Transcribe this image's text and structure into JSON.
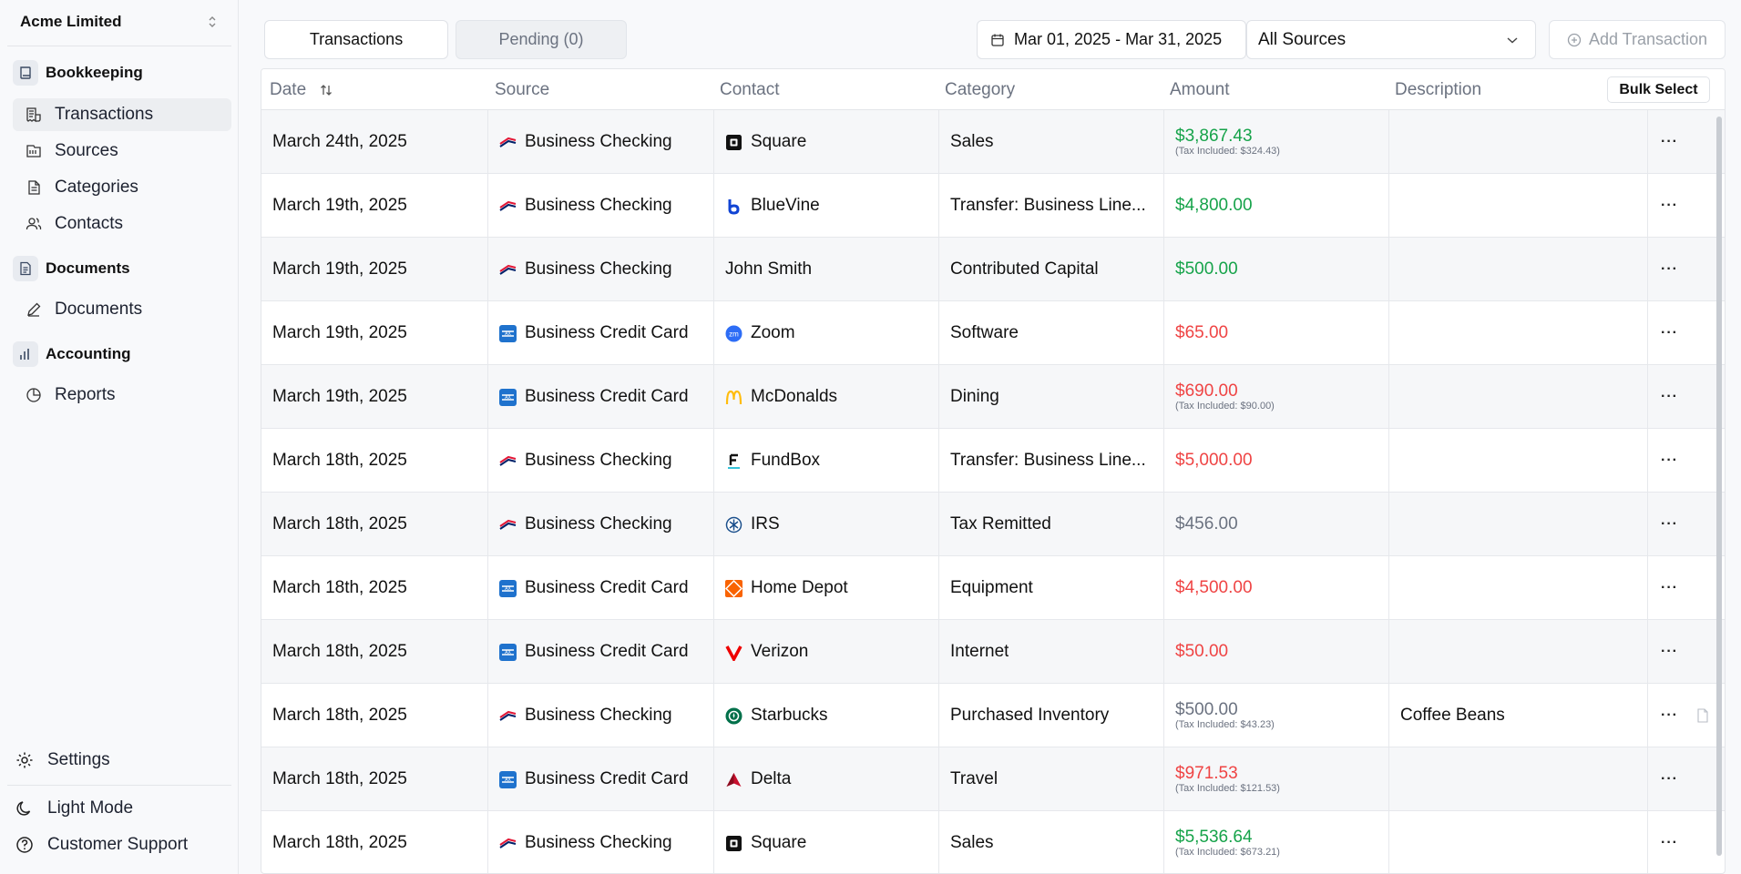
{
  "sidebar": {
    "company": "Acme Limited",
    "sections": [
      {
        "label": "Bookkeeping",
        "icon": "book-icon",
        "items": [
          {
            "label": "Transactions",
            "icon": "receipt-icon",
            "active": true
          },
          {
            "label": "Sources",
            "icon": "bank-icon"
          },
          {
            "label": "Categories",
            "icon": "file-list-icon"
          },
          {
            "label": "Contacts",
            "icon": "users-icon"
          }
        ]
      },
      {
        "label": "Documents",
        "icon": "document-icon",
        "items": [
          {
            "label": "Documents",
            "icon": "pencil-icon"
          }
        ]
      },
      {
        "label": "Accounting",
        "icon": "bar-chart-icon",
        "items": [
          {
            "label": "Reports",
            "icon": "pie-chart-icon"
          }
        ]
      }
    ],
    "settings": "Settings",
    "light_mode": "Light Mode",
    "support": "Customer Support"
  },
  "toolbar": {
    "tab_transactions": "Transactions",
    "tab_pending": "Pending (0)",
    "date_range": "Mar 01, 2025 - Mar 31, 2025",
    "sources": "All Sources",
    "add": "Add Transaction"
  },
  "table": {
    "headers": {
      "date": "Date",
      "source": "Source",
      "contact": "Contact",
      "category": "Category",
      "amount": "Amount",
      "description": "Description"
    },
    "bulk_select": "Bulk Select",
    "rows": [
      {
        "date": "March 24th, 2025",
        "source": "Business Checking",
        "source_logo": "bank-of-america",
        "contact": "Square",
        "contact_logo": "square",
        "category": "Sales",
        "amount": "$3,867.43",
        "amount_color": "#16a34a",
        "tax": "(Tax Included: $324.43)",
        "description": ""
      },
      {
        "date": "March 19th, 2025",
        "source": "Business Checking",
        "source_logo": "bank-of-america",
        "contact": "BlueVine",
        "contact_logo": "bluevine",
        "category": "Transfer: Business Line...",
        "amount": "$4,800.00",
        "amount_color": "#16a34a",
        "tax": "",
        "description": ""
      },
      {
        "date": "March 19th, 2025",
        "source": "Business Checking",
        "source_logo": "bank-of-america",
        "contact": "John Smith",
        "contact_logo": "",
        "category": "Contributed Capital",
        "amount": "$500.00",
        "amount_color": "#16a34a",
        "tax": "",
        "description": ""
      },
      {
        "date": "March 19th, 2025",
        "source": "Business Credit Card",
        "source_logo": "amex",
        "contact": "Zoom",
        "contact_logo": "zoom",
        "category": "Software",
        "amount": "$65.00",
        "amount_color": "#ef4444",
        "tax": "",
        "description": ""
      },
      {
        "date": "March 19th, 2025",
        "source": "Business Credit Card",
        "source_logo": "amex",
        "contact": "McDonalds",
        "contact_logo": "mcdonalds",
        "category": "Dining",
        "amount": "$690.00",
        "amount_color": "#ef4444",
        "tax": "(Tax Included: $90.00)",
        "description": ""
      },
      {
        "date": "March 18th, 2025",
        "source": "Business Checking",
        "source_logo": "bank-of-america",
        "contact": "FundBox",
        "contact_logo": "fundbox",
        "category": "Transfer: Business Line...",
        "amount": "$5,000.00",
        "amount_color": "#ef4444",
        "tax": "",
        "description": ""
      },
      {
        "date": "March 18th, 2025",
        "source": "Business Checking",
        "source_logo": "bank-of-america",
        "contact": "IRS",
        "contact_logo": "irs",
        "category": "Tax Remitted",
        "amount": "$456.00",
        "amount_color": "#6b7280",
        "tax": "",
        "description": ""
      },
      {
        "date": "March 18th, 2025",
        "source": "Business Credit Card",
        "source_logo": "amex",
        "contact": "Home Depot",
        "contact_logo": "home-depot",
        "category": "Equipment",
        "amount": "$4,500.00",
        "amount_color": "#ef4444",
        "tax": "",
        "description": ""
      },
      {
        "date": "March 18th, 2025",
        "source": "Business Credit Card",
        "source_logo": "amex",
        "contact": "Verizon",
        "contact_logo": "verizon",
        "category": "Internet",
        "amount": "$50.00",
        "amount_color": "#ef4444",
        "tax": "",
        "description": ""
      },
      {
        "date": "March 18th, 2025",
        "source": "Business Checking",
        "source_logo": "bank-of-america",
        "contact": "Starbucks",
        "contact_logo": "starbucks",
        "category": "Purchased Inventory",
        "amount": "$500.00",
        "amount_color": "#6b7280",
        "tax": "(Tax Included: $43.23)",
        "description": "Coffee Beans",
        "has_attachment": true
      },
      {
        "date": "March 18th, 2025",
        "source": "Business Credit Card",
        "source_logo": "amex",
        "contact": "Delta",
        "contact_logo": "delta",
        "category": "Travel",
        "amount": "$971.53",
        "amount_color": "#ef4444",
        "tax": "(Tax Included: $121.53)",
        "description": ""
      },
      {
        "date": "March 18th, 2025",
        "source": "Business Checking",
        "source_logo": "bank-of-america",
        "contact": "Square",
        "contact_logo": "square",
        "category": "Sales",
        "amount": "$5,536.64",
        "amount_color": "#16a34a",
        "tax": "(Tax Included: $673.21)",
        "description": ""
      }
    ]
  }
}
